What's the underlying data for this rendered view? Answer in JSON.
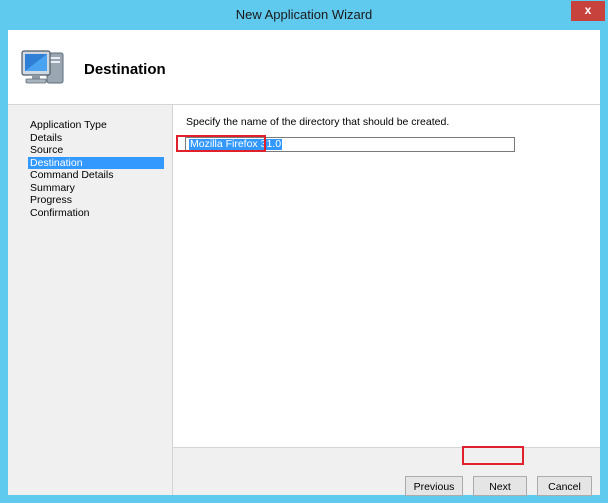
{
  "window": {
    "title": "New Application Wizard",
    "close_glyph": "x",
    "accent_color": "#5fc9ee"
  },
  "header": {
    "icon": "computer-icon",
    "title": "Destination"
  },
  "steps": [
    {
      "label": "Application Type",
      "active": false
    },
    {
      "label": "Details",
      "active": false
    },
    {
      "label": "Source",
      "active": false
    },
    {
      "label": "Destination",
      "active": true
    },
    {
      "label": "Command Details",
      "active": false
    },
    {
      "label": "Summary",
      "active": false
    },
    {
      "label": "Progress",
      "active": false
    },
    {
      "label": "Confirmation",
      "active": false
    }
  ],
  "content": {
    "instruction": "Specify the name of the directory that should be created.",
    "directory_value": "Mozilla Firefox 31.0"
  },
  "buttons": {
    "previous": "Previous",
    "next": "Next",
    "cancel": "Cancel"
  },
  "highlight_color": "#e0202a"
}
